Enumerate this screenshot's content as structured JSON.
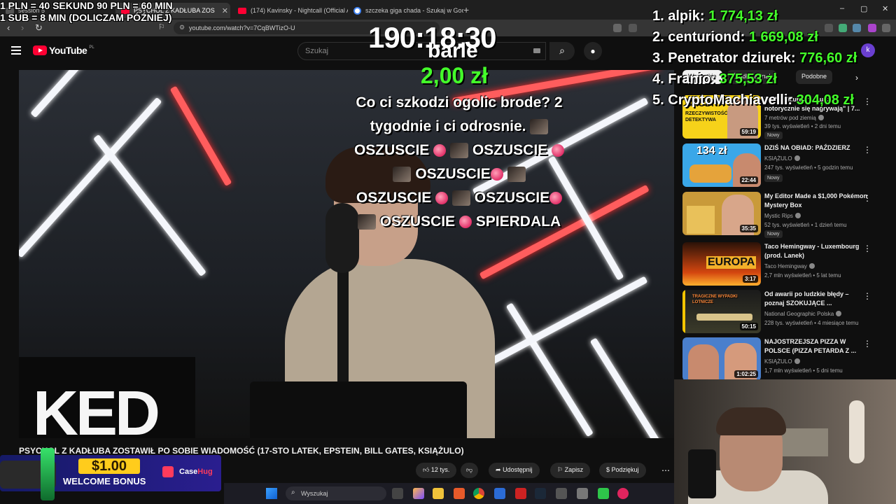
{
  "browser": {
    "tabs": [
      {
        "label": "session 5"
      },
      {
        "label": "PSYCHOL Z KADŁUBA ZOS"
      },
      {
        "label": "(174) Kavinsky - Nightcall (Official Au"
      },
      {
        "label": "szczeka giga chada - Szukaj w Googl"
      }
    ],
    "new_tab": "+",
    "window_controls": [
      "–",
      "▢",
      "✕"
    ],
    "url": "youtube.com/watch?v=7CqBWTizO-U"
  },
  "youtube": {
    "logo_text": "YouTube",
    "logo_region": "PL",
    "search_placeholder": "Szukaj",
    "avatar_letter": "k"
  },
  "overlay": {
    "rate_line1": "1 PLN = 40 SEKUND 90 PLN = 60 MIN",
    "rate_line2": "1 SUB = 8 MIN (DOLICZAM PÓŹNIEJ)",
    "timer": "190:18:30",
    "donor": "barle",
    "donation_amount": "2,00 zł",
    "message_line1": "Co ci szkodzi ogolic brode? 2",
    "message_line2": "tygodnie i ci odrosnie.",
    "spam_word": "OSZUSCIE",
    "spam_end": "SPIERDALA",
    "leaderboard": [
      {
        "rank": "1.",
        "name": "alpik:",
        "value": "1 774,13 zł"
      },
      {
        "rank": "2.",
        "name": "centuriond:",
        "value": "1 669,08 zł"
      },
      {
        "rank": "3.",
        "name": "Penetrator dziurek:",
        "value": "776,60 zł"
      },
      {
        "rank": "4.",
        "name": "Franio:",
        "value": "375,53 zł"
      },
      {
        "rank": "5.",
        "name": "CryptoMachiavelli:",
        "value": "304,08 zł"
      }
    ]
  },
  "video": {
    "board_text": "KED",
    "title": "PSYCHOL Z KADŁUBA ZOSTAWIŁ PO SOBIE WIADOMOŚĆ (17-STO LATEK, EPSTEIN, BILL GATES, KSIĄŻULO)",
    "likes": "12 tys.",
    "share": "Udostępnij",
    "save": "Zapisz",
    "thanks": "Podziękuj"
  },
  "sidebar": {
    "chips": [
      "Wszystkie",
      "Źródło: Kanał",
      "Podobne"
    ],
    "recommendations": [
      {
        "title": "Perfect Murder: \"Ludzie notorycznie się nagrywają\" | 7...",
        "channel": "7 metrów pod ziemią",
        "meta": "39 tys. wyświetleń • 2 dni temu",
        "duration": "59:19",
        "badge": "Nowy",
        "thumb_text": "BRUDNA",
        "thumb_sub": "RZECZYWISTOŚĆ DETEKTYWA",
        "thumb_color": "#f6d21a"
      },
      {
        "title": "DZIŚ NA OBIAD: PAŹDZIERZ",
        "channel": "KSIĄŻULO",
        "meta": "247 tys. wyświetleń • 5 godzin temu",
        "duration": "22:44",
        "badge": "Nowy",
        "thumb_text": "134 zł",
        "thumb_color": "#3aa7e8"
      },
      {
        "title": "My Editor Made a $1,000 Pokémon Mystery Box",
        "channel": "Mystic Rips",
        "meta": "52 tys. wyświetleń • 1 dzień temu",
        "duration": "35:35",
        "badge": "Nowy",
        "thumb_text": "",
        "thumb_color": "#c99a3a"
      },
      {
        "title": "Taco Hemingway - Luxembourg (prod. Lanek)",
        "channel": "Taco Hemingway",
        "meta": "2,7 mln wyświetleń • 5 lat temu",
        "duration": "3:17",
        "badge": "",
        "thumb_text": "EUROPA",
        "thumb_color": "#d4460f"
      },
      {
        "title": "Od awarii po ludzkie błędy – poznaj SZOKUJĄCE ...",
        "channel": "National Geographic Polska",
        "meta": "228 tys. wyświetleń • 4 miesiące temu",
        "duration": "50:15",
        "badge": "",
        "thumb_text": "TRAGICZNE WYPADKI LOTNICZE",
        "thumb_color": "#2a2a2a"
      },
      {
        "title": "NAJOSTRZEJSZA PIZZA W POLSCE (PIZZA PETARDA Z ...",
        "channel": "KSIĄŻULO",
        "meta": "1,7 mln wyświetleń • 5 dni temu",
        "duration": "1:02:25",
        "badge": "",
        "thumb_text": "",
        "thumb_color": "#4a7fcc"
      }
    ]
  },
  "ad": {
    "price": "$1.00",
    "bonus": "WELCOME BONUS",
    "brand_a": "Case",
    "brand_b": "Hug"
  },
  "taskbar": {
    "search_placeholder": "Wyszukaj"
  },
  "colors": {
    "green": "#44ff2a",
    "yt_red": "#ff0033"
  }
}
